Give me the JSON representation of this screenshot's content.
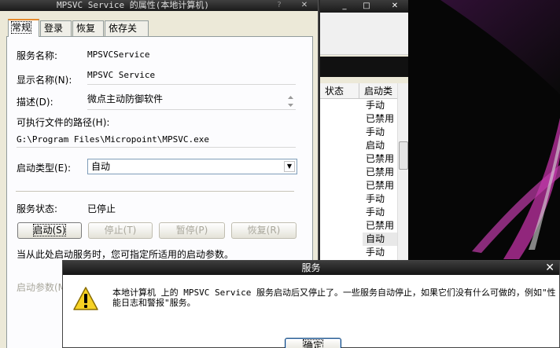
{
  "property_dialog": {
    "title": "MPSVC Service 的属性(本地计算机)",
    "tabs": [
      {
        "label": "常规",
        "active": true
      },
      {
        "label": "登录",
        "active": false
      },
      {
        "label": "恢复",
        "active": false
      },
      {
        "label": "依存关系",
        "active": false
      }
    ],
    "service_name_label": "服务名称:",
    "service_name": "MPSVCService",
    "display_name_label": "显示名称(N):",
    "display_name": "MPSVC Service",
    "description_label": "描述(D):",
    "description": "微点主动防御软件",
    "exe_path_label": "可执行文件的路径(H):",
    "exe_path": "G:\\Program Files\\Micropoint\\MPSVC.exe",
    "startup_type_label": "启动类型(E):",
    "startup_type": "自动",
    "status_label": "服务状态:",
    "status_value": "已停止",
    "buttons": {
      "start": "启动(S)",
      "stop": "停止(T)",
      "pause": "暂停(P)",
      "resume": "恢复(R)"
    },
    "start_hint": "当从此处启动服务时，您可指定所适用的启动参数。",
    "start_params_label": "启动参数(M):"
  },
  "services_list": {
    "columns": [
      "状态",
      "启动类"
    ],
    "startup_types": [
      "手动",
      "已禁用",
      "手动",
      "启动",
      "已禁用",
      "已禁用",
      "已禁用",
      "手动",
      "手动",
      "已禁用",
      "自动",
      "手动"
    ]
  },
  "message_box": {
    "title": "服务",
    "message": "本地计算机 上的 MPSVC Service 服务启动后又停止了。一些服务自动停止，如果它们没有什么可做的，例如\"性能日志和警报\"服务。",
    "ok_label": "确定",
    "icon": "warning-icon"
  },
  "icons": {
    "help": "?",
    "close": "✕",
    "minimize": "_",
    "maximize": "□",
    "dropdown": "▼"
  }
}
